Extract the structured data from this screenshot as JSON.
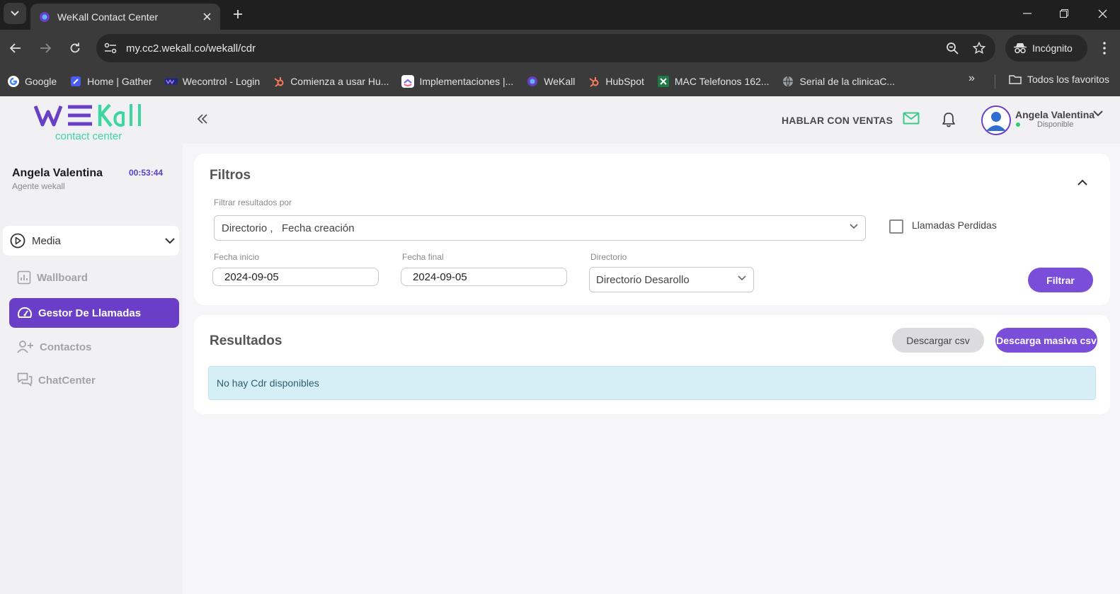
{
  "browser": {
    "tab_title": "WeKall Contact Center",
    "url": "my.cc2.wekall.co/wekall/cdr",
    "incognito_label": "Incógnito",
    "bookmarks": [
      {
        "label": "Google",
        "icon": "google-icon"
      },
      {
        "label": "Home | Gather",
        "icon": "gather-icon"
      },
      {
        "label": "Wecontrol - Login",
        "icon": "wecontrol-icon"
      },
      {
        "label": "Comienza a usar Hu...",
        "icon": "hubspot-icon"
      },
      {
        "label": "Implementaciones |...",
        "icon": "clickup-icon"
      },
      {
        "label": "WeKall",
        "icon": "wekall-icon"
      },
      {
        "label": "HubSpot",
        "icon": "hubspot-icon"
      },
      {
        "label": "MAC Telefonos 162...",
        "icon": "excel-icon"
      },
      {
        "label": "Serial de la clinicaC...",
        "icon": "globe-icon"
      }
    ],
    "bookmarks_more": "»",
    "all_bookmarks_label": "Todos los favoritos"
  },
  "sidebar": {
    "logo_text": "WE Kall",
    "logo_sub": "contact center",
    "agent_name": "Angela Valentina",
    "agent_role": "Agente wekall",
    "timer": "00:53:44",
    "media_label": "Media",
    "items": [
      {
        "label": "Wallboard",
        "icon": "chart-icon",
        "active": false
      },
      {
        "label": "Gestor De Llamadas",
        "icon": "gauge-icon",
        "active": true
      },
      {
        "label": "Contactos",
        "icon": "add-user-icon",
        "active": false
      },
      {
        "label": "ChatCenter",
        "icon": "chat-icon",
        "active": false
      }
    ]
  },
  "header": {
    "talk_sales": "HABLAR CON VENTAS",
    "user_name": "Angela Valentina",
    "user_status": "Disponible"
  },
  "filters": {
    "title": "Filtros",
    "filter_by_label": "Filtrar resultados por",
    "filter_by_value": "Directorio ,   Fecha creación",
    "missed_calls_label": "Llamadas Perdidas",
    "start_date_label": "Fecha inicio",
    "start_date": "2024-09-05",
    "end_date_label": "Fecha final",
    "end_date": "2024-09-05",
    "directory_label": "Directorio",
    "directory_value": "Directorio Desarollo",
    "filter_button": "Filtrar"
  },
  "results": {
    "title": "Resultados",
    "download_csv": "Descargar csv",
    "bulk_download_csv": "Descarga masiva csv",
    "empty_message": "No hay Cdr disponibles"
  },
  "colors": {
    "accent": "#7a4ed8",
    "active_nav": "#6b3ec8",
    "logo_purple": "#6a3fc7",
    "logo_green": "#3ed6a0"
  }
}
